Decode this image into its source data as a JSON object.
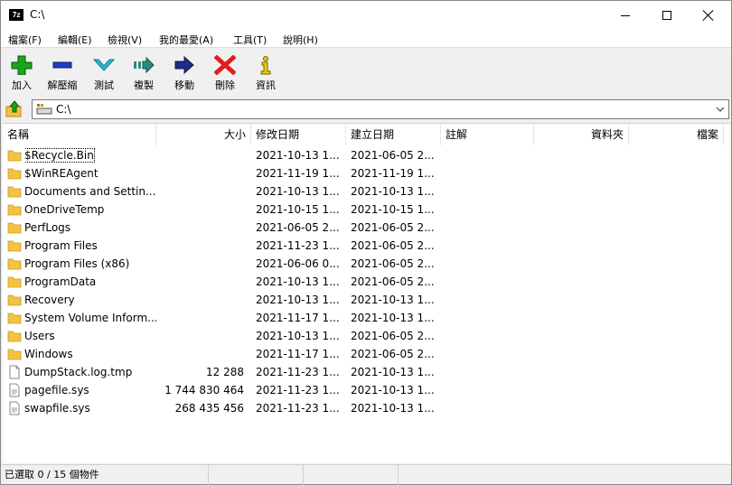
{
  "window": {
    "icon_text": "7z",
    "title": "C:\\"
  },
  "menu": [
    "檔案(F)",
    "編輯(E)",
    "檢視(V)",
    "我的最愛(A)",
    "工具(T)",
    "說明(H)"
  ],
  "toolbar": {
    "add": "加入",
    "extract": "解壓縮",
    "test": "測試",
    "copy": "複製",
    "move": "移動",
    "delete": "刪除",
    "info": "資訊"
  },
  "address": {
    "path": "C:\\"
  },
  "columns": {
    "name": "名稱",
    "size": "大小",
    "modified": "修改日期",
    "created": "建立日期",
    "comment": "註解",
    "folders": "資料夾",
    "files": "檔案"
  },
  "files": [
    {
      "name": "$Recycle.Bin",
      "size": "",
      "modified": "2021-10-13 1...",
      "created": "2021-06-05 2...",
      "type": "folder"
    },
    {
      "name": "$WinREAgent",
      "size": "",
      "modified": "2021-11-19 1...",
      "created": "2021-11-19 1...",
      "type": "folder"
    },
    {
      "name": "Documents and Settin...",
      "size": "",
      "modified": "2021-10-13 1...",
      "created": "2021-10-13 1...",
      "type": "folder"
    },
    {
      "name": "OneDriveTemp",
      "size": "",
      "modified": "2021-10-15 1...",
      "created": "2021-10-15 1...",
      "type": "folder"
    },
    {
      "name": "PerfLogs",
      "size": "",
      "modified": "2021-06-05 2...",
      "created": "2021-06-05 2...",
      "type": "folder"
    },
    {
      "name": "Program Files",
      "size": "",
      "modified": "2021-11-23 1...",
      "created": "2021-06-05 2...",
      "type": "folder"
    },
    {
      "name": "Program Files (x86)",
      "size": "",
      "modified": "2021-06-06 0...",
      "created": "2021-06-05 2...",
      "type": "folder"
    },
    {
      "name": "ProgramData",
      "size": "",
      "modified": "2021-10-13 1...",
      "created": "2021-06-05 2...",
      "type": "folder"
    },
    {
      "name": "Recovery",
      "size": "",
      "modified": "2021-10-13 1...",
      "created": "2021-10-13 1...",
      "type": "folder"
    },
    {
      "name": "System Volume Inform...",
      "size": "",
      "modified": "2021-11-17 1...",
      "created": "2021-10-13 1...",
      "type": "folder"
    },
    {
      "name": "Users",
      "size": "",
      "modified": "2021-10-13 1...",
      "created": "2021-06-05 2...",
      "type": "folder"
    },
    {
      "name": "Windows",
      "size": "",
      "modified": "2021-11-17 1...",
      "created": "2021-06-05 2...",
      "type": "folder"
    },
    {
      "name": "DumpStack.log.tmp",
      "size": "12 288",
      "modified": "2021-11-23 1...",
      "created": "2021-10-13 1...",
      "type": "file"
    },
    {
      "name": "pagefile.sys",
      "size": "1 744 830 464",
      "modified": "2021-11-23 1...",
      "created": "2021-10-13 1...",
      "type": "sysfile"
    },
    {
      "name": "swapfile.sys",
      "size": "268 435 456",
      "modified": "2021-11-23 1...",
      "created": "2021-10-13 1...",
      "type": "sysfile"
    }
  ],
  "status": {
    "selected": "已選取 0 / 15 個物件"
  },
  "colors": {
    "folder": "#f5c342",
    "add_green": "#1aa51a",
    "extract_blue": "#1f3fbf",
    "test_cyan": "#2fb8d6",
    "copy_teal": "#2b8a7e",
    "move_navy": "#1d2f8a",
    "delete_red": "#e01e1e",
    "info_yellow": "#e8d000"
  }
}
